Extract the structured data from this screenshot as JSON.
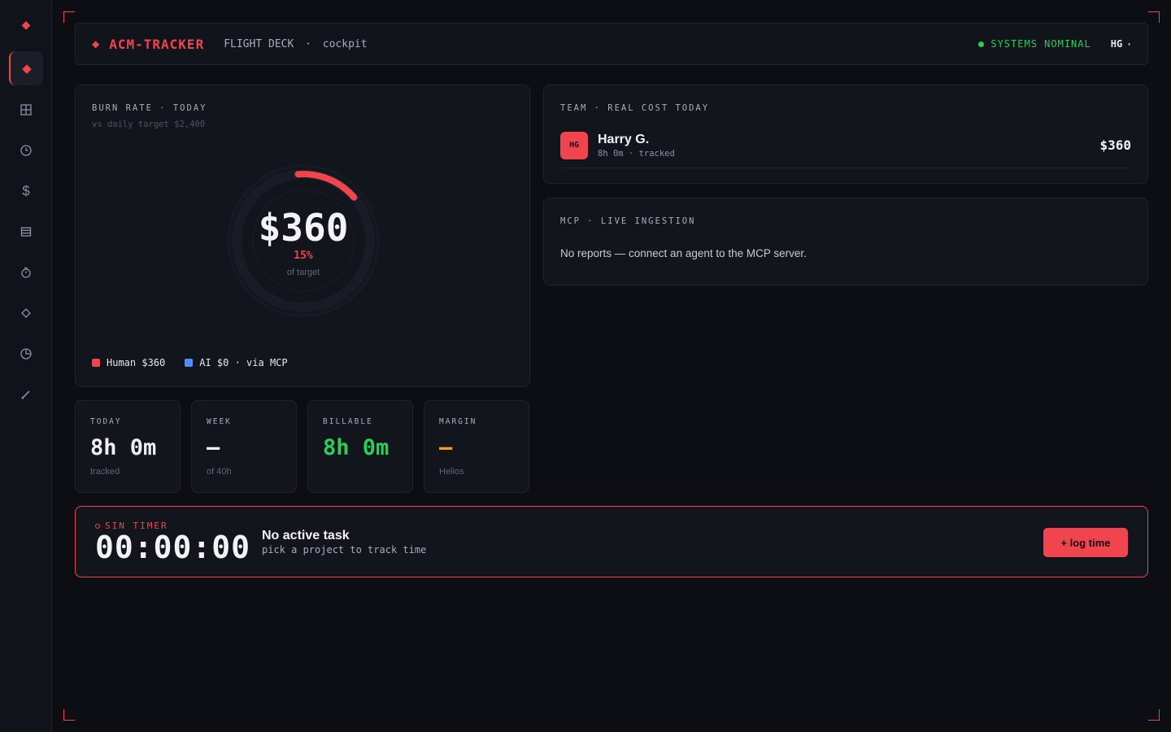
{
  "sidebar": {
    "items": [
      {
        "icon": "diamond-icon"
      },
      {
        "icon": "cockpit-icon",
        "active": true
      },
      {
        "icon": "grid-icon"
      },
      {
        "icon": "clock-icon"
      },
      {
        "icon": "dollar-icon"
      },
      {
        "icon": "list-icon"
      },
      {
        "icon": "timer-icon"
      },
      {
        "icon": "diamond-outline-icon"
      },
      {
        "icon": "pie-chart-icon"
      },
      {
        "icon": "pencil-icon"
      }
    ]
  },
  "header": {
    "brand": "ACM-TRACKER",
    "crumb_section": "FLIGHT DECK",
    "crumb_separator": "·",
    "crumb_page": "cockpit",
    "status": "SYSTEMS NOMINAL",
    "user_initials": "HG",
    "caret": "▾"
  },
  "burn": {
    "label": "BURN RATE · TODAY",
    "sublabel": "vs daily target $2,400",
    "value": "$360",
    "percent": "15%",
    "percent_value": 0.15,
    "percent_caption": "of target",
    "legend": [
      {
        "label": "Human $360",
        "color": "#f0454f"
      },
      {
        "label": "AI $0 · via MCP",
        "color": "#4f8ef7"
      }
    ]
  },
  "team": {
    "label": "TEAM · REAL COST TODAY",
    "members": [
      {
        "initials": "HG",
        "name": "Harry G.",
        "meta": "8h 0m · tracked",
        "cost": "$360"
      }
    ]
  },
  "mcp": {
    "label": "MCP · LIVE INGESTION",
    "empty_text": "No reports — connect an agent to the MCP server."
  },
  "stats": {
    "today": {
      "label": "TODAY",
      "value": "8h 0m",
      "sub": "tracked"
    },
    "week": {
      "label": "WEEK",
      "value": "—",
      "sub": "of 40h"
    },
    "billable": {
      "label": "BILLABLE",
      "value": "8h 0m",
      "sub": ""
    },
    "margin": {
      "label": "MARGIN",
      "value": "—",
      "sub": "Helios"
    }
  },
  "timer": {
    "label": "SIN TIMER",
    "clock": "00:00:00",
    "task_title": "No active task",
    "task_sub": "pick a project to track time",
    "button": "+ log time"
  },
  "colors": {
    "accent": "#f0454f",
    "success": "#2ecc5a",
    "warning": "#f59e1b",
    "ai": "#4f8ef7"
  }
}
